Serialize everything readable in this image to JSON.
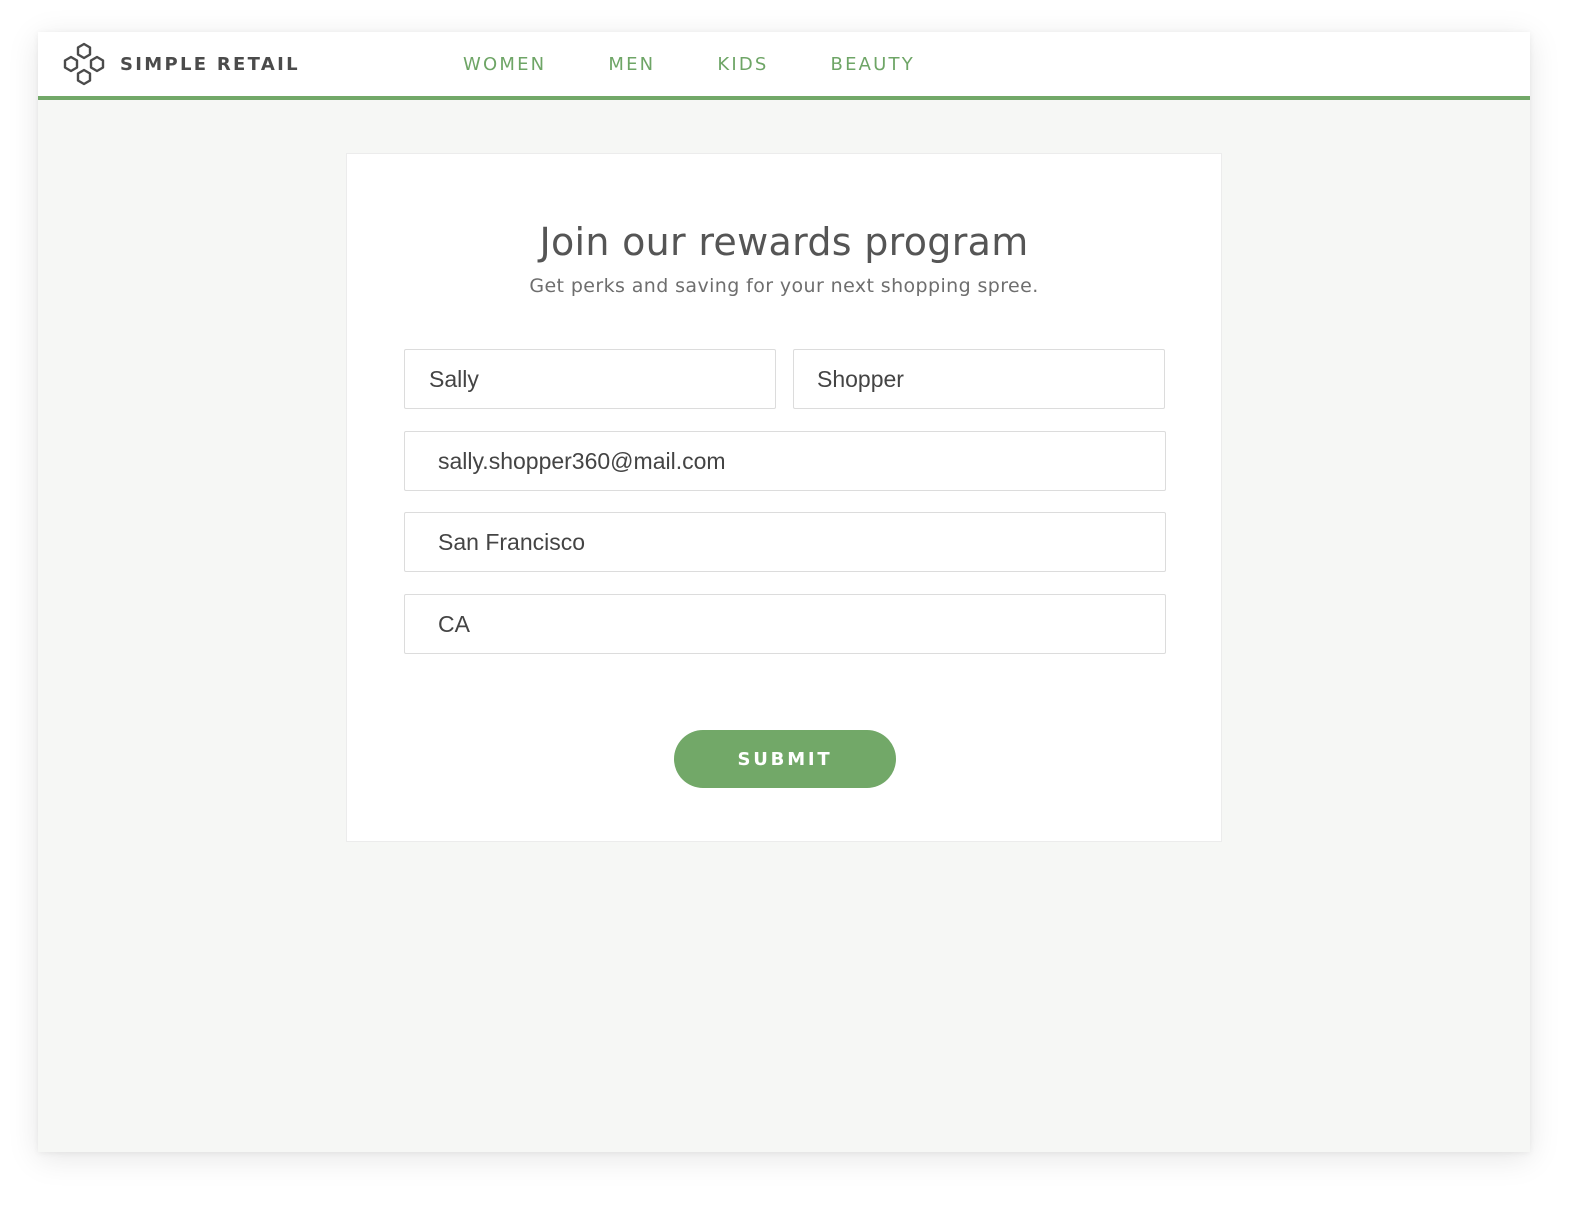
{
  "brand": {
    "name": "SIMPLE RETAIL",
    "logo_icon": "hexagon-flower-logo-icon"
  },
  "nav": {
    "items": [
      {
        "label": "WOMEN"
      },
      {
        "label": "MEN"
      },
      {
        "label": "KIDS"
      },
      {
        "label": "BEAUTY"
      }
    ]
  },
  "form": {
    "title": "Join our rewards program",
    "subtitle": "Get perks and saving for your next shopping spree.",
    "first_name": "Sally",
    "last_name": "Shopper",
    "email": "sally.shopper360@mail.com",
    "city": "San Francisco",
    "state": "CA",
    "submit_label": "SUBMIT"
  },
  "colors": {
    "accent": "#72a868",
    "nav_text": "#6ea566",
    "background": "#f6f7f5",
    "text": "#444444"
  }
}
